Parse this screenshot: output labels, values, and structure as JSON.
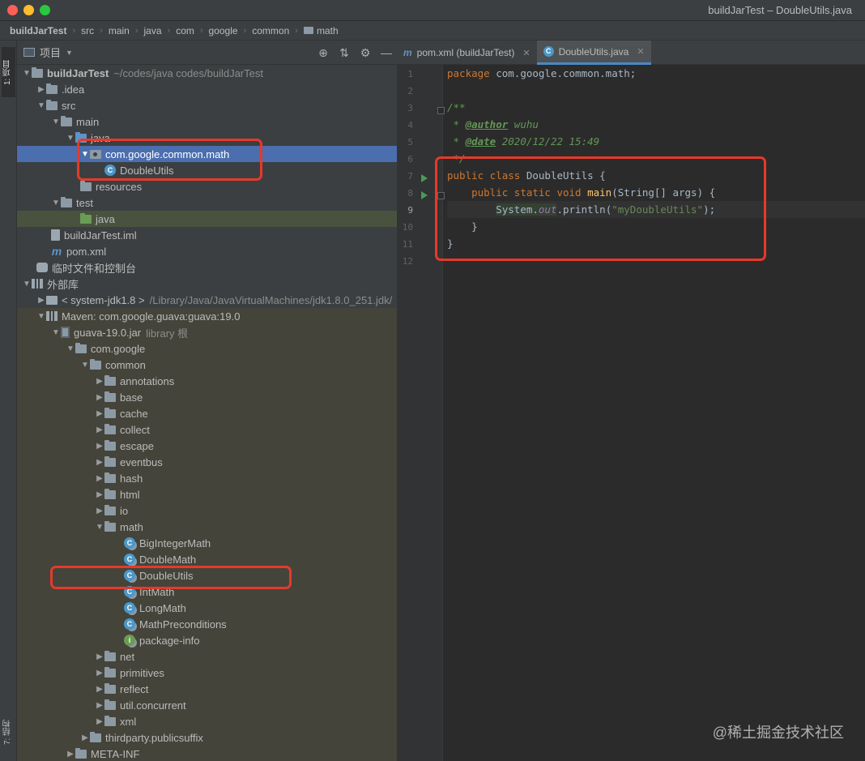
{
  "window": {
    "title": "buildJarTest – DoubleUtils.java"
  },
  "breadcrumb": [
    "buildJarTest",
    "src",
    "main",
    "java",
    "com",
    "google",
    "common",
    "math"
  ],
  "toolstrip": {
    "project_tab": "1: 项目",
    "structure_tab": "7: 结构"
  },
  "project_panel": {
    "title": "项目",
    "tools": [
      "⊕",
      "⇅",
      "⚙",
      "—"
    ],
    "tree": [
      {
        "label": "buildJarTest",
        "hint": "~/codes/java codes/buildJarTest"
      },
      {
        "label": ".idea"
      },
      {
        "label": "src"
      },
      {
        "label": "main"
      },
      {
        "label": "java"
      },
      {
        "label": "com.google.common.math"
      },
      {
        "label": "DoubleUtils"
      },
      {
        "label": "resources"
      },
      {
        "label": "test"
      },
      {
        "label": "java"
      },
      {
        "label": "buildJarTest.iml"
      },
      {
        "label": "pom.xml"
      },
      {
        "label": "临时文件和控制台"
      },
      {
        "label": "外部库"
      },
      {
        "label": "< system-jdk1.8 >",
        "hint": "/Library/Java/JavaVirtualMachines/jdk1.8.0_251.jdk/"
      },
      {
        "label": "Maven: com.google.guava:guava:19.0"
      },
      {
        "label": "guava-19.0.jar",
        "hint": "library 根"
      },
      {
        "label": "com.google"
      },
      {
        "label": "common"
      },
      {
        "label": "annotations"
      },
      {
        "label": "base"
      },
      {
        "label": "cache"
      },
      {
        "label": "collect"
      },
      {
        "label": "escape"
      },
      {
        "label": "eventbus"
      },
      {
        "label": "hash"
      },
      {
        "label": "html"
      },
      {
        "label": "io"
      },
      {
        "label": "math"
      },
      {
        "label": "BigIntegerMath"
      },
      {
        "label": "DoubleMath"
      },
      {
        "label": "DoubleUtils"
      },
      {
        "label": "IntMath"
      },
      {
        "label": "LongMath"
      },
      {
        "label": "MathPreconditions"
      },
      {
        "label": "package-info"
      },
      {
        "label": "net"
      },
      {
        "label": "primitives"
      },
      {
        "label": "reflect"
      },
      {
        "label": "util.concurrent"
      },
      {
        "label": "xml"
      },
      {
        "label": "thirdparty.publicsuffix"
      },
      {
        "label": "META-INF"
      }
    ]
  },
  "editor": {
    "tabs": [
      {
        "label": "pom.xml (buildJarTest)",
        "icon": "m-icon"
      },
      {
        "label": "DoubleUtils.java",
        "icon": "class-icon"
      }
    ],
    "line_numbers": [
      "1",
      "2",
      "3",
      "4",
      "5",
      "6",
      "7",
      "8",
      "9",
      "10",
      "11",
      "12"
    ],
    "code": {
      "l1_kw": "package",
      "l1_rest": " com.google.common.math;",
      "l3": "/**",
      "l4_star": " * ",
      "l4_tag": "@author",
      "l4_val": " wuhu",
      "l5_star": " * ",
      "l5_tag": "@date",
      "l5_val": " 2020/12/22 15:49",
      "l6": " */",
      "l7_kw": "public class",
      "l7_rest": " DoubleUtils {",
      "l8_indent": "    ",
      "l8_kw": "public static void",
      "l8_fn": " main",
      "l8_rest": "(String[] args) {",
      "l9_indent": "        ",
      "l9_sys": "System.",
      "l9_fld": "out",
      "l9_mid": ".println(",
      "l9_str": "\"myDoubleUtils\"",
      "l9_end": ");",
      "l10": "    }",
      "l11": "}"
    }
  },
  "watermark": "@稀土掘金技术社区",
  "colors": {
    "annotation": "#e53a2a",
    "selection": "#4b6eaf",
    "keyword": "#cc7832",
    "string": "#6a8759",
    "comment": "#629755"
  }
}
